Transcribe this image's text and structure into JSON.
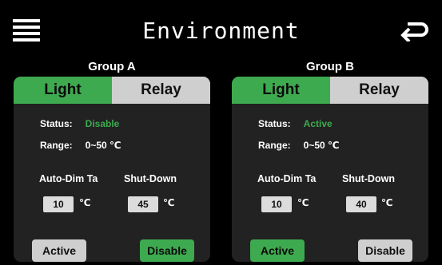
{
  "header": {
    "title": "Environment",
    "menu_icon": "hamburger-menu-icon",
    "back_icon": "return-arrow-icon"
  },
  "colors": {
    "accent_green": "#3eaa4f",
    "tab_inactive": "#cfcfcf",
    "panel_bg": "#222222"
  },
  "groups": [
    {
      "title": "Group A",
      "tabs": {
        "light": "Light",
        "relay": "Relay",
        "selected": "Light"
      },
      "status_label": "Status:",
      "status_value": "Disable",
      "range_label": "Range:",
      "range_value": "0~50 ℃",
      "auto_dim_label": "Auto-Dim Ta",
      "auto_dim_value": "10",
      "shut_down_label": "Shut-Down",
      "shut_down_value": "45",
      "unit": "℃",
      "active_label": "Active",
      "disable_label": "Disable",
      "selected_mode": "Disable"
    },
    {
      "title": "Group B",
      "tabs": {
        "light": "Light",
        "relay": "Relay",
        "selected": "Light"
      },
      "status_label": "Status:",
      "status_value": "Active",
      "range_label": "Range:",
      "range_value": "0~50 ℃",
      "auto_dim_label": "Auto-Dim Ta",
      "auto_dim_value": "10",
      "shut_down_label": "Shut-Down",
      "shut_down_value": "40",
      "unit": "℃",
      "active_label": "Active",
      "disable_label": "Disable",
      "selected_mode": "Active"
    }
  ]
}
